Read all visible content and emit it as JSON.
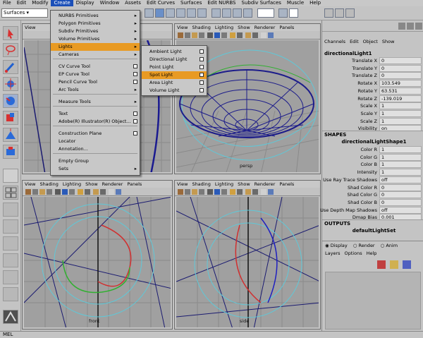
{
  "menubar": [
    "File",
    "Edit",
    "Modify",
    "Create",
    "Display",
    "Window",
    "Assets",
    "Edit Curves",
    "Surfaces",
    "Edit NURBS",
    "Subdiv Surfaces",
    "Muscle",
    "Help"
  ],
  "status": {
    "mode": "Surfaces"
  },
  "create_menu": {
    "items": [
      {
        "label": "NURBS Primitives",
        "sub": true
      },
      {
        "label": "Polygon Primitives",
        "sub": true
      },
      {
        "label": "Subdiv Primitives",
        "sub": true
      },
      {
        "label": "Volume Primitives",
        "sub": true
      },
      {
        "label": "Lights",
        "sub": true,
        "selected": true
      },
      {
        "label": "Cameras",
        "sub": true
      },
      {
        "label": "CV Curve Tool",
        "opt": true
      },
      {
        "label": "EP Curve Tool",
        "opt": true
      },
      {
        "label": "Pencil Curve Tool",
        "opt": true
      },
      {
        "label": "Arc Tools",
        "sub": true
      },
      {
        "label": "Measure Tools",
        "sub": true
      },
      {
        "label": "Text",
        "opt": true
      },
      {
        "label": "Adobe(R) Illustrator(R) Object...",
        "opt": true
      },
      {
        "label": "Construction Plane",
        "opt": true
      },
      {
        "label": "Locator"
      },
      {
        "label": "Annotation..."
      },
      {
        "label": "Empty Group"
      },
      {
        "label": "Sets",
        "sub": true
      }
    ]
  },
  "lights_menu": {
    "items": [
      {
        "label": "Ambient Light"
      },
      {
        "label": "Directional Light"
      },
      {
        "label": "Point Light"
      },
      {
        "label": "Spot Light",
        "selected": true
      },
      {
        "label": "Area Light"
      },
      {
        "label": "Volume Light"
      }
    ]
  },
  "viewport_menu": [
    "View",
    "Shading",
    "Lighting",
    "Show",
    "Renderer",
    "Panels"
  ],
  "viewports": {
    "persp": "persp",
    "front": "front",
    "side": "side"
  },
  "channel_box": {
    "tabs": [
      "Channels",
      "Edit",
      "Object",
      "Show"
    ],
    "node": "directionalLight1",
    "attrs": [
      {
        "label": "Translate X",
        "value": "0"
      },
      {
        "label": "Translate Y",
        "value": "0"
      },
      {
        "label": "Translate Z",
        "value": "0"
      },
      {
        "label": "Rotate X",
        "value": "103.549"
      },
      {
        "label": "Rotate Y",
        "value": "63.531"
      },
      {
        "label": "Rotate Z",
        "value": "-139.019"
      },
      {
        "label": "Scale X",
        "value": "1"
      },
      {
        "label": "Scale Y",
        "value": "1"
      },
      {
        "label": "Scale Z",
        "value": "1"
      },
      {
        "label": "Visibility",
        "value": "on"
      }
    ],
    "shapes_header": "SHAPES",
    "shape_node": "directionalLightShape1",
    "shape_attrs": [
      {
        "label": "Color R",
        "value": "1"
      },
      {
        "label": "Color G",
        "value": "1"
      },
      {
        "label": "Color B",
        "value": "1"
      },
      {
        "label": "Intensity",
        "value": "1"
      },
      {
        "label": "Use Ray Trace Shadows",
        "value": "off"
      },
      {
        "label": "Shad Color R",
        "value": "0"
      },
      {
        "label": "Shad Color G",
        "value": "0"
      },
      {
        "label": "Shad Color B",
        "value": "0"
      },
      {
        "label": "Use Depth Map Shadows",
        "value": "off"
      },
      {
        "label": "Dmap Bias",
        "value": "0.001"
      }
    ],
    "outputs_header": "OUTPUTS",
    "output_node": "defaultLightSet",
    "layer_modes": [
      "Display",
      "Render",
      "Anim"
    ],
    "layer_menu": [
      "Layers",
      "Options",
      "Help"
    ]
  },
  "help_line": "MEL"
}
